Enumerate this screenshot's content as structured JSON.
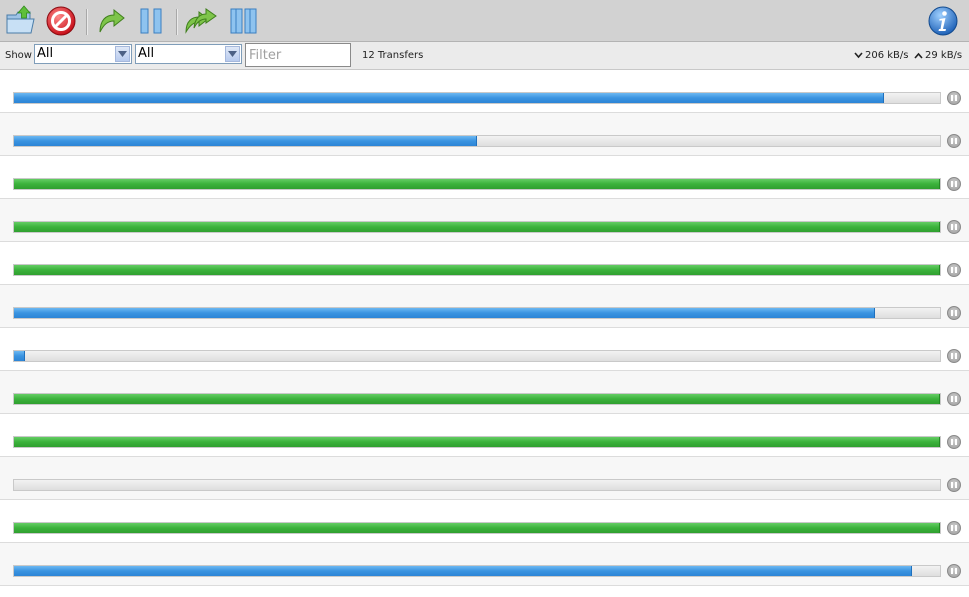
{
  "toolbar": {
    "buttons": [
      {
        "name": "open-torrent-button",
        "icon": "folder-open-icon"
      },
      {
        "name": "remove-torrent-button",
        "icon": "stop-sign-icon"
      },
      {
        "name": "resume-selected-button",
        "icon": "resume-arrow-icon"
      },
      {
        "name": "pause-selected-button",
        "icon": "pause-icon"
      },
      {
        "name": "resume-all-button",
        "icon": "double-arrow-icon"
      },
      {
        "name": "pause-all-button",
        "icon": "pause-all-icon"
      },
      {
        "name": "about-button",
        "icon": "info-icon"
      }
    ]
  },
  "filterbar": {
    "show_label": "Show",
    "filter1": "All",
    "filter2": "All",
    "filter_placeholder": "Filter",
    "transfer_count": "12 Transfers",
    "download_speed": "206 kB/s",
    "upload_speed": "29 kB/s"
  },
  "colors": {
    "downloading": "#3a93e0",
    "done": "#3bb23b",
    "toolbar": "#d2d2d2"
  },
  "transfers": [
    {
      "progress": 0.94,
      "status": "downloading"
    },
    {
      "progress": 0.5,
      "status": "downloading"
    },
    {
      "progress": 1.0,
      "status": "done"
    },
    {
      "progress": 1.0,
      "status": "done"
    },
    {
      "progress": 1.0,
      "status": "done"
    },
    {
      "progress": 0.93,
      "status": "downloading"
    },
    {
      "progress": 0.012,
      "status": "downloading"
    },
    {
      "progress": 1.0,
      "status": "done"
    },
    {
      "progress": 1.0,
      "status": "done"
    },
    {
      "progress": 0.0,
      "status": "paused"
    },
    {
      "progress": 1.0,
      "status": "done"
    },
    {
      "progress": 0.97,
      "status": "downloading"
    }
  ]
}
